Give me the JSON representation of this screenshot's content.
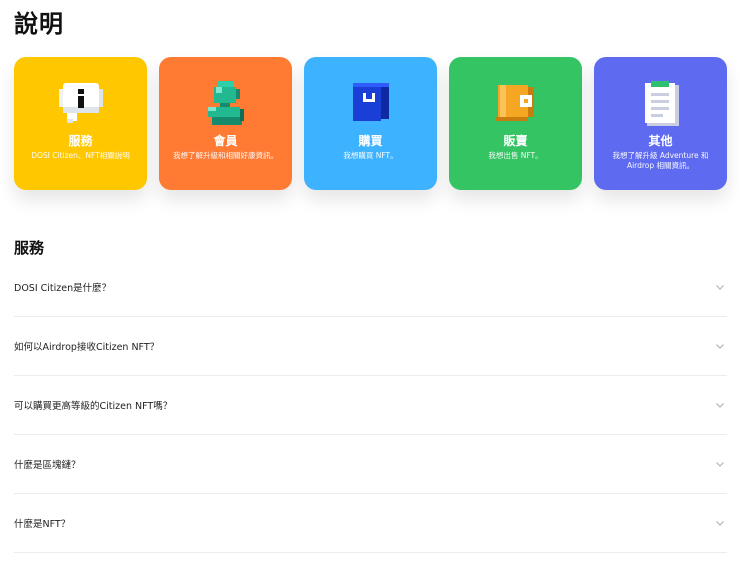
{
  "page": {
    "title": "說明"
  },
  "cards": [
    {
      "id": "service",
      "title": "服務",
      "desc": "DOSI Citizen、NFT相關說明",
      "color": "#FFC700",
      "icon": "speech-bubble-info-icon"
    },
    {
      "id": "member",
      "title": "會員",
      "desc": "我想了解升級和相關好康資訊。",
      "color": "#FF7A33",
      "icon": "member-person-icon"
    },
    {
      "id": "buy",
      "title": "購買",
      "desc": "我想購買 NFT。",
      "color": "#3DB2FF",
      "icon": "shopping-bag-icon"
    },
    {
      "id": "sell",
      "title": "販賣",
      "desc": "我想出售 NFT。",
      "color": "#34C463",
      "icon": "wallet-icon"
    },
    {
      "id": "other",
      "title": "其他",
      "desc": "我想了解升級 Adventure 和 Airdrop 相關資訊。",
      "color": "#5E6AF0",
      "icon": "document-icon"
    }
  ],
  "faq": {
    "title": "服務",
    "items": [
      {
        "q": "DOSI Citizen是什麼？"
      },
      {
        "q": "如何以Airdrop接收Citizen NFT？"
      },
      {
        "q": "可以購買更高等級的Citizen NFT嗎？"
      },
      {
        "q": "什麼是區塊鏈？"
      },
      {
        "q": "什麼是NFT？"
      }
    ]
  }
}
